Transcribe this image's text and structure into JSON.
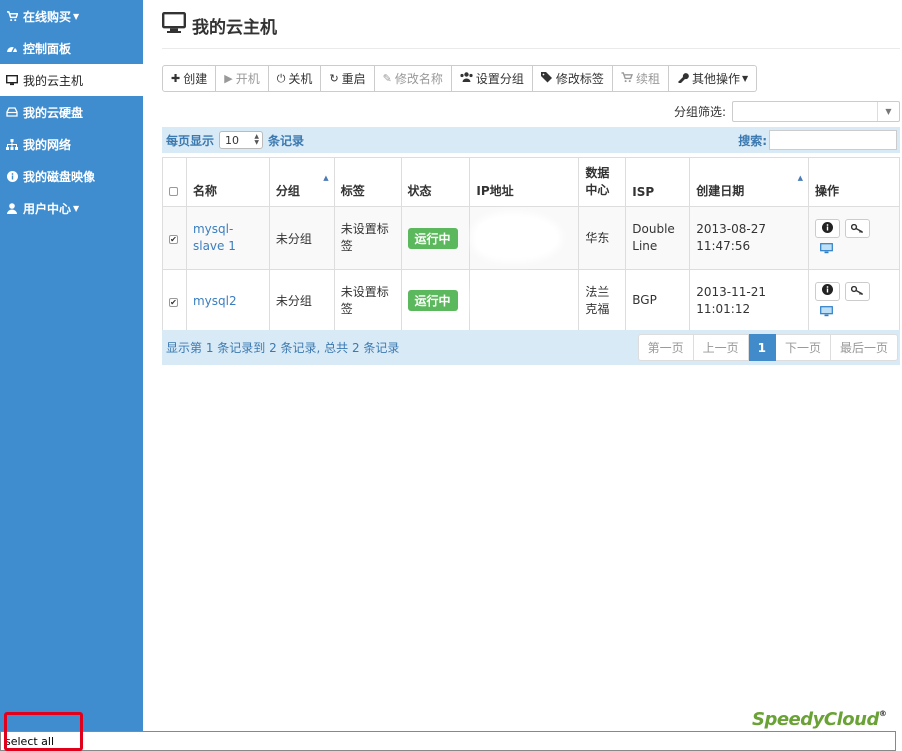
{
  "sidebar": {
    "items": [
      {
        "label": "在线购买",
        "icon": "cart-icon",
        "caret": true
      },
      {
        "label": "控制面板",
        "icon": "dashboard-icon"
      },
      {
        "label": "我的云主机",
        "icon": "monitor-icon",
        "active": true
      },
      {
        "label": "我的云硬盘",
        "icon": "hdd-icon"
      },
      {
        "label": "我的网络",
        "icon": "network-icon"
      },
      {
        "label": "我的磁盘映像",
        "icon": "info-icon"
      },
      {
        "label": "用户中心",
        "icon": "user-icon",
        "caret": true
      }
    ]
  },
  "page": {
    "title": "我的云主机"
  },
  "toolbar": {
    "create": "创建",
    "start": "开机",
    "shutdown": "关机",
    "restart": "重启",
    "rename": "修改名称",
    "set_group": "设置分组",
    "edit_tags": "修改标签",
    "renew": "续租",
    "other": "其他操作"
  },
  "filter": {
    "label": "分组筛选:",
    "value": ""
  },
  "table_controls": {
    "show_prefix": "每页显示",
    "page_size": "10",
    "show_suffix": "条记录",
    "search_label": "搜索:",
    "search_value": ""
  },
  "table": {
    "headers": [
      "名称",
      "分组",
      "标签",
      "状态",
      "IP地址",
      "数据中心",
      "ISP",
      "创建日期",
      "操作"
    ],
    "rows": [
      {
        "checked": true,
        "name": "mysql-slave 1",
        "group": "未分组",
        "tag": "未设置标签",
        "status": "运行中",
        "ip": "",
        "dc": "华东",
        "isp": "Double Line",
        "date": "2013-08-27 11:47:56"
      },
      {
        "checked": true,
        "name": "mysql2",
        "group": "未分组",
        "tag": "未设置标签",
        "status": "运行中",
        "ip": "",
        "dc": "法兰克福",
        "isp": "BGP",
        "date": "2013-11-21 11:01:12"
      }
    ]
  },
  "footer": {
    "info": "显示第 1 条记录到 2 条记录, 总共 2 条记录",
    "pages": [
      "第一页",
      "上一页",
      "1",
      "下一页",
      "最后一页"
    ]
  },
  "brand": {
    "logo": "SpeedyCloud",
    "reg": "®"
  },
  "status_bar": {
    "text": "select all"
  },
  "colors": {
    "sidebar": "#3f8ccf",
    "accent": "#428bca",
    "status_green": "#5cb85c",
    "highlight": "#e0001b"
  }
}
